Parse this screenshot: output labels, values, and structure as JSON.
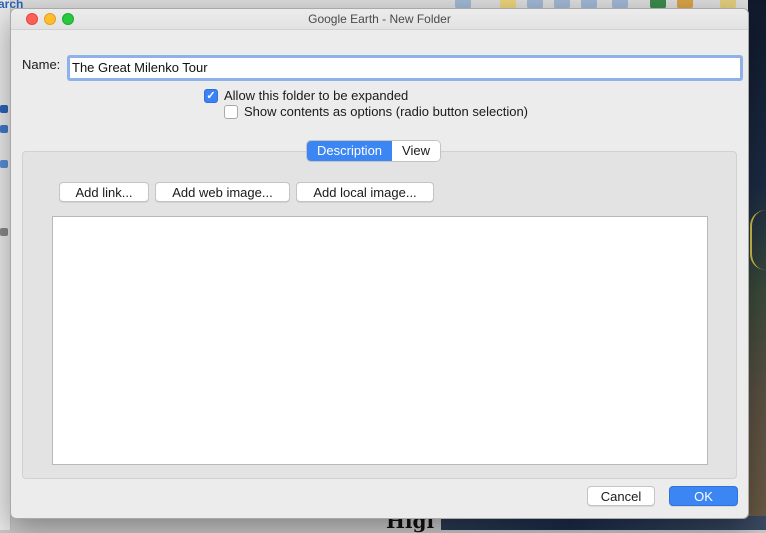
{
  "window": {
    "title": "Google Earth - New Folder"
  },
  "name_field": {
    "label": "Name:",
    "value": "The Great Milenko Tour"
  },
  "options": {
    "allow_expand": {
      "label": "Allow this folder to be expanded",
      "checked": true
    },
    "show_radio": {
      "label": "Show contents as options (radio button selection)",
      "checked": false
    }
  },
  "tabs": [
    {
      "label": "Description",
      "active": true
    },
    {
      "label": "View",
      "active": false
    }
  ],
  "description_toolbar": {
    "add_link": "Add link...",
    "add_web_image": "Add web image...",
    "add_local_image": "Add local image..."
  },
  "description_text": "",
  "footer": {
    "cancel": "Cancel",
    "ok": "OK"
  },
  "background": {
    "left_panel_label": "arch",
    "bottom_text": "Higl"
  },
  "colors": {
    "accent": "#3c86f4",
    "focus_ring": "#8fb1ea",
    "close": "#fe5f57",
    "minimize": "#febc2e",
    "maximize": "#28c840"
  }
}
